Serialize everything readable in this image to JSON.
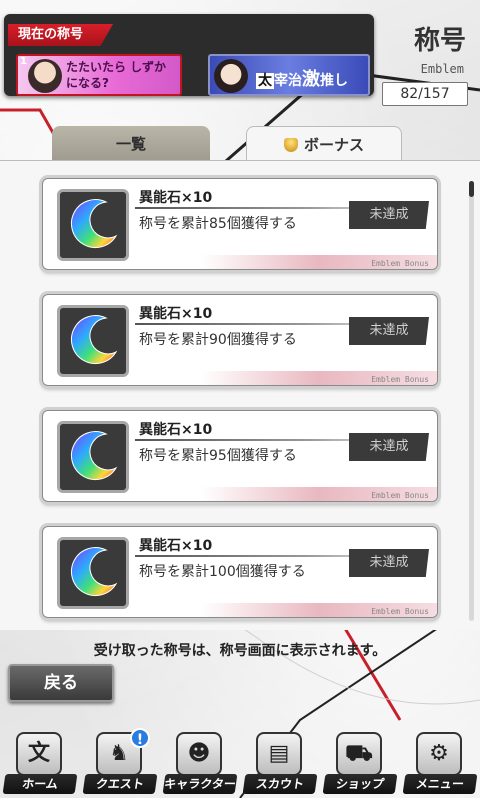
{
  "current": {
    "label": "現在の称号",
    "emblem1": {
      "num": "1",
      "text": "たたいたら しずかになる?"
    },
    "emblem2": {
      "box": "太",
      "text1": "宰治",
      "big": "激",
      "text2": "推し"
    }
  },
  "header": {
    "title": "称号",
    "subtitle": "Emblem",
    "counter": "82/157"
  },
  "tabs": {
    "list": "一覧",
    "bonus": "ボーナス"
  },
  "items": [
    {
      "reward": "異能石×10",
      "condition": "称号を累計85個獲得する",
      "status": "未達成",
      "footer": "Emblem Bonus"
    },
    {
      "reward": "異能石×10",
      "condition": "称号を累計90個獲得する",
      "status": "未達成",
      "footer": "Emblem Bonus"
    },
    {
      "reward": "異能石×10",
      "condition": "称号を累計95個獲得する",
      "status": "未達成",
      "footer": "Emblem Bonus"
    },
    {
      "reward": "異能石×10",
      "condition": "称号を累計100個獲得する",
      "status": "未達成",
      "footer": "Emblem Bonus"
    }
  ],
  "notice": "受け取った称号は、称号画面に表示されます。",
  "back": "戻る",
  "nav": [
    {
      "label": "ホーム",
      "icon": "文"
    },
    {
      "label": "クエスト",
      "icon": "♞",
      "badge": "!"
    },
    {
      "label": "キャラクター",
      "icon": "☻"
    },
    {
      "label": "スカウト",
      "icon": "▤"
    },
    {
      "label": "ショップ",
      "icon": "⛟"
    },
    {
      "label": "メニュー",
      "icon": "⚙"
    }
  ]
}
